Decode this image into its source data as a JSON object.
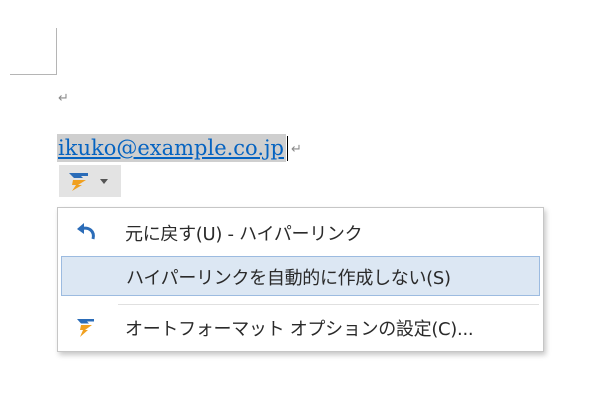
{
  "document": {
    "paragraph_mark": "↵",
    "line_mark": "↵",
    "hyperlink_text": "ikuko@example.co.jp"
  },
  "autocorrect_options": {
    "icon": "lightning-bolt-icon",
    "dropdown_icon": "chevron-down-icon"
  },
  "menu": {
    "items": [
      {
        "icon": "undo-icon",
        "label": "元に戻す(U) - ハイパーリンク"
      },
      {
        "icon": "",
        "label": "ハイパーリンクを自動的に作成しない(S)"
      },
      {
        "icon": "autoformat-lightning-icon",
        "label": "オートフォーマット オプションの設定(C)..."
      }
    ]
  },
  "colors": {
    "hyperlink": "#0563c1",
    "selection_highlight": "#cfcfcf",
    "menu_hover": "#dce7f3",
    "icon_blue": "#2b6cb8",
    "icon_orange": "#f0a020"
  }
}
